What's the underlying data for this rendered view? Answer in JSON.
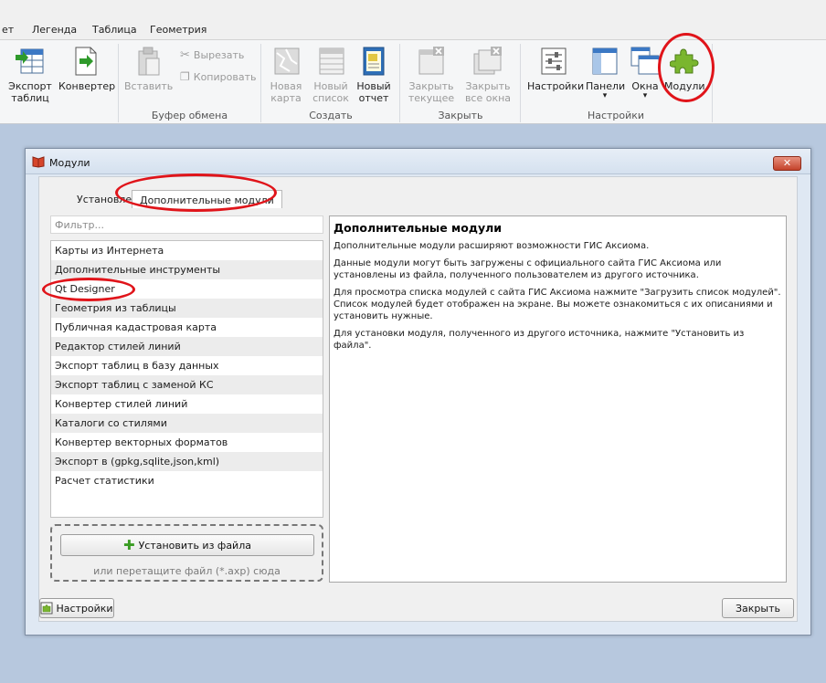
{
  "menu": [
    "ет",
    "Легенда",
    "Таблица",
    "Геометрия"
  ],
  "ribbon": {
    "export_tables": "Экспорт\nтаблиц",
    "converter": "Конвертер",
    "paste": "Вставить",
    "cut": "Вырезать",
    "copy": "Копировать",
    "clipboard_group": "Буфер обмена",
    "new_map": "Новая\nкарта",
    "new_list": "Новый\nсписок",
    "new_report": "Новый\nотчет",
    "create_group": "Создать",
    "close_current": "Закрыть\nтекущее",
    "close_all": "Закрыть\nвсе окна",
    "close_group": "Закрыть",
    "settings": "Настройки",
    "panels": "Панели",
    "windows": "Окна",
    "modules": "Модули",
    "settings_group": "Настройки",
    "dropdown_arrow": "▾"
  },
  "dialog": {
    "title": "Модули",
    "close_glyph": "✕",
    "tabs": [
      "Установлено",
      "Дополнительные модули"
    ],
    "filter_placeholder": "Фильтр...",
    "modules": [
      "Карты из Интернета",
      "Дополнительные инструменты",
      "Qt Designer",
      "Геометрия из таблицы",
      "Публичная кадастровая карта",
      "Редактор стилей линий",
      "Экспорт таблиц в базу данных",
      "Экспорт таблиц с заменой КС",
      "Конвертер стилей линий",
      "Каталоги со стилями",
      "Конвертер векторных форматов",
      "Экспорт в (gpkg,sqlite,json,kml)",
      "Расчет статистики"
    ],
    "install_button": "Установить из файла",
    "plus_glyph": "✚",
    "drop_hint": "или перетащите файл (*.axp) сюда",
    "description": {
      "heading": "Дополнительные модули",
      "p1": "Дополнительные модули расширяют возможности ГИС Аксиома.",
      "p2": "Данные модули могут быть загружены с официального сайта ГИС Аксиома или установлены из файла, полученного пользователем из другого источника.",
      "p3": "Для просмотра списка модулей с сайта ГИС Аксиома нажмите \"Загрузить список модулей\". Список модулей будет отображен на экране. Вы можете ознакомиться с их описаниями и установить нужные.",
      "p4": "Для установки модуля, полученного из другого источника, нажмите \"Установить из файла\"."
    },
    "settings_button": "Настройки",
    "close_button": "Закрыть"
  },
  "colors": {
    "highlight_circle": "#e0141a",
    "plus": "#3a9c23"
  }
}
